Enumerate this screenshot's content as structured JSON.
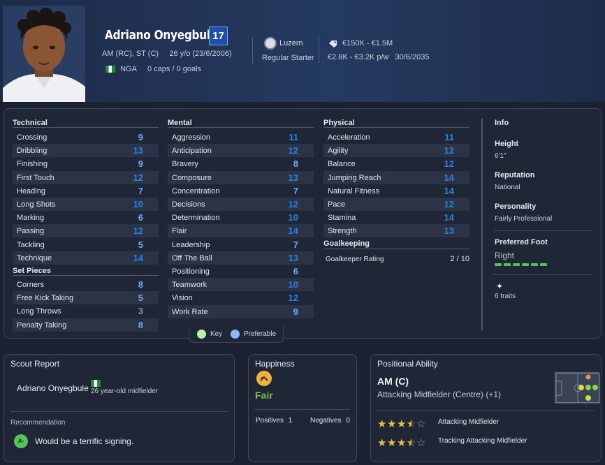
{
  "player": {
    "name": "Adriano Onyegbule",
    "squad_number": "17",
    "positions_age": "AM (RC), ST (C)     26 y/o (23/6/2006)",
    "nationality": "NGA",
    "caps": "0 caps / 0 goals",
    "club": "Luzern",
    "status": "Regular Starter",
    "value": "€150K - €1.5M",
    "wage": "€2.8K - €3.2K p/w",
    "contract_end": "30/6/2035"
  },
  "colors": {
    "high": "#2d7fe6",
    "mid": "#6da8ff",
    "low": "#8a93a4"
  },
  "attributes": {
    "technical": {
      "title": "Technical",
      "items": [
        {
          "name": "Crossing",
          "value": "9",
          "tone": "mid"
        },
        {
          "name": "Dribbling",
          "value": "13",
          "tone": "high"
        },
        {
          "name": "Finishing",
          "value": "9",
          "tone": "mid"
        },
        {
          "name": "First Touch",
          "value": "12",
          "tone": "high"
        },
        {
          "name": "Heading",
          "value": "7",
          "tone": "mid"
        },
        {
          "name": "Long Shots",
          "value": "10",
          "tone": "high"
        },
        {
          "name": "Marking",
          "value": "6",
          "tone": "mid"
        },
        {
          "name": "Passing",
          "value": "12",
          "tone": "high"
        },
        {
          "name": "Tackling",
          "value": "5",
          "tone": "mid"
        },
        {
          "name": "Technique",
          "value": "14",
          "tone": "high"
        }
      ]
    },
    "set_pieces": {
      "title": "Set Pieces",
      "items": [
        {
          "name": "Corners",
          "value": "8",
          "tone": "mid"
        },
        {
          "name": "Free Kick Taking",
          "value": "5",
          "tone": "mid"
        },
        {
          "name": "Long Throws",
          "value": "3",
          "tone": "low"
        },
        {
          "name": "Penalty Taking",
          "value": "8",
          "tone": "mid"
        }
      ]
    },
    "mental": {
      "title": "Mental",
      "items": [
        {
          "name": "Aggression",
          "value": "11",
          "tone": "high"
        },
        {
          "name": "Anticipation",
          "value": "12",
          "tone": "high"
        },
        {
          "name": "Bravery",
          "value": "8",
          "tone": "mid"
        },
        {
          "name": "Composure",
          "value": "13",
          "tone": "high"
        },
        {
          "name": "Concentration",
          "value": "7",
          "tone": "mid"
        },
        {
          "name": "Decisions",
          "value": "12",
          "tone": "high"
        },
        {
          "name": "Determination",
          "value": "10",
          "tone": "high"
        },
        {
          "name": "Flair",
          "value": "14",
          "tone": "high"
        },
        {
          "name": "Leadership",
          "value": "7",
          "tone": "mid"
        },
        {
          "name": "Off The Ball",
          "value": "13",
          "tone": "high"
        },
        {
          "name": "Positioning",
          "value": "6",
          "tone": "mid"
        },
        {
          "name": "Teamwork",
          "value": "10",
          "tone": "high"
        },
        {
          "name": "Vision",
          "value": "12",
          "tone": "high"
        },
        {
          "name": "Work Rate",
          "value": "9",
          "tone": "mid"
        }
      ]
    },
    "physical": {
      "title": "Physical",
      "items": [
        {
          "name": "Acceleration",
          "value": "11",
          "tone": "high"
        },
        {
          "name": "Agility",
          "value": "12",
          "tone": "high"
        },
        {
          "name": "Balance",
          "value": "12",
          "tone": "high"
        },
        {
          "name": "Jumping Reach",
          "value": "14",
          "tone": "high"
        },
        {
          "name": "Natural Fitness",
          "value": "14",
          "tone": "high"
        },
        {
          "name": "Pace",
          "value": "12",
          "tone": "high"
        },
        {
          "name": "Stamina",
          "value": "14",
          "tone": "high"
        },
        {
          "name": "Strength",
          "value": "13",
          "tone": "high"
        }
      ]
    },
    "goalkeeping": {
      "title": "Goalkeeping",
      "label": "Goalkeeper Rating",
      "value": "2 / 10"
    }
  },
  "info": {
    "title": "Info",
    "height_label": "Height",
    "height": "6'1\"",
    "reputation_label": "Reputation",
    "reputation": "National",
    "personality_label": "Personality",
    "personality": "Fairly Professional",
    "foot_label": "Preferred Foot",
    "foot": "Right",
    "foot_level": 1.0,
    "traits": "6 traits"
  },
  "legend": {
    "key": "Key",
    "preferable": "Preferable"
  },
  "scout": {
    "title": "Scout Report",
    "name": "Adriano Onyegbule",
    "desc": "26 year-old midfielder",
    "rec_label": "Recommendation",
    "grade": "A-",
    "rec_text": "Would be a terrific signing."
  },
  "happiness": {
    "title": "Happiness",
    "status": "Fair",
    "positives_label": "Positives",
    "positives": "1",
    "negatives_label": "Negatives",
    "negatives": "0"
  },
  "positional": {
    "title": "Positional Ability",
    "position": "AM (C)",
    "role": "Attacking Midfielder (Centre) (+1)",
    "roles": [
      {
        "name": "Attacking Midfielder",
        "rating": 3.5
      },
      {
        "name": "Tracking Attacking Midfielder",
        "rating": 3.5
      }
    ]
  }
}
